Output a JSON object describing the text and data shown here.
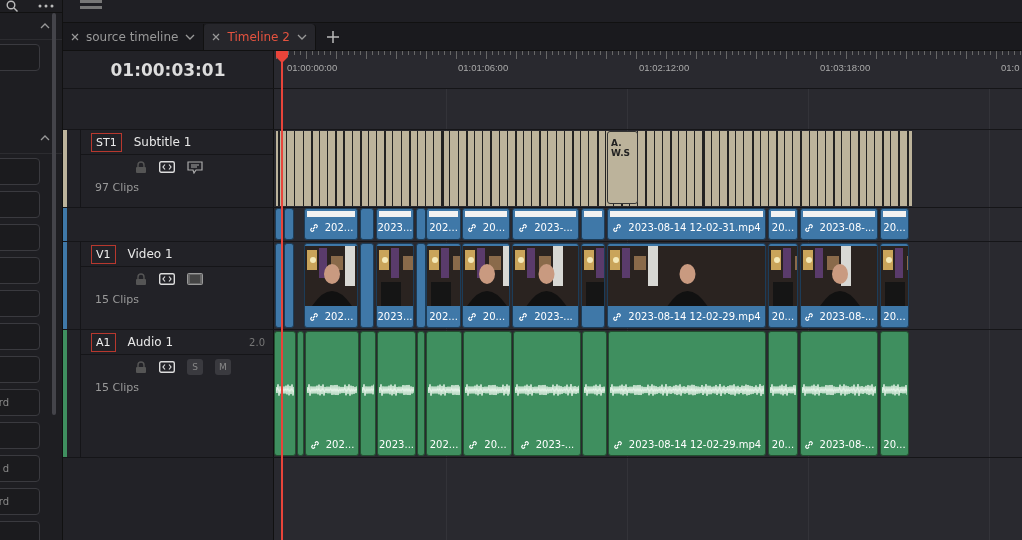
{
  "sidebar": {
    "panels": [
      {
        "expanded": true,
        "buttons": [
          {
            "kind": "blank"
          }
        ]
      },
      {
        "expanded": true,
        "buttons": [
          {
            "kind": "blank"
          },
          {
            "kind": "blank"
          },
          {
            "kind": "blank"
          },
          {
            "kind": "blank"
          },
          {
            "kind": "blank"
          },
          {
            "kind": "blank"
          },
          {
            "kind": "blank"
          },
          {
            "kind": "text",
            "label": "rd"
          },
          {
            "kind": "blank"
          },
          {
            "kind": "text",
            "label": "d"
          },
          {
            "kind": "text",
            "label": "rd"
          },
          {
            "kind": "blank"
          }
        ]
      }
    ]
  },
  "tabs": [
    {
      "label": "source timeline",
      "selected": false
    },
    {
      "label": "Timeline 2",
      "selected": true
    }
  ],
  "timecode": "01:00:03:01",
  "ruler": [
    "01:00:00:00",
    "01:01:06:00",
    "01:02:12:00",
    "01:03:18:00",
    "01:0"
  ],
  "tracks": [
    {
      "kind": "subtitle",
      "badge": "ST1",
      "name": "Subtitle 1",
      "clip_count": "97 Clips",
      "clips": [
        {
          "lines": [
            "A.",
            "W.S"
          ]
        }
      ]
    },
    {
      "kind": "video_strip",
      "clips": [
        {
          "linked": false
        },
        {
          "linked": false
        },
        {
          "label": "202...",
          "linked": true
        },
        {
          "linked": false
        },
        {
          "label": "2023...",
          "linked": false
        },
        {
          "linked": false
        },
        {
          "label": "202...",
          "linked": false
        },
        {
          "label": "20...",
          "linked": true
        },
        {
          "label": "2023-...",
          "linked": true
        },
        {
          "linked": false
        },
        {
          "label": "2023-08-14 12-02-31.mp4",
          "linked": true
        },
        {
          "label": "20...",
          "linked": false
        },
        {
          "label": "2023-08-...",
          "linked": true
        },
        {
          "label": "20...",
          "linked": false
        }
      ]
    },
    {
      "kind": "video",
      "badge": "V1",
      "name": "Video 1",
      "clip_count": "15 Clips",
      "clips": [
        {
          "linked": false
        },
        {
          "linked": false
        },
        {
          "label": "202...",
          "linked": true
        },
        {
          "linked": false
        },
        {
          "label": "2023...",
          "linked": false
        },
        {
          "linked": false
        },
        {
          "label": "202...",
          "linked": false
        },
        {
          "label": "20...",
          "linked": true
        },
        {
          "label": "2023-...",
          "linked": true
        },
        {
          "linked": false
        },
        {
          "label": "2023-08-14 12-02-29.mp4",
          "linked": true
        },
        {
          "label": "20...",
          "linked": false
        },
        {
          "label": "2023-08-...",
          "linked": true
        },
        {
          "label": "20...",
          "linked": false
        }
      ]
    },
    {
      "kind": "audio",
      "badge": "A1",
      "name": "Audio 1",
      "format": "2.0",
      "solo": "S",
      "mute": "M",
      "clip_count": "15 Clips",
      "clips": [
        {
          "linked": false
        },
        {
          "linked": false
        },
        {
          "label": "202...",
          "linked": true
        },
        {
          "linked": false
        },
        {
          "label": "2023...",
          "linked": false
        },
        {
          "linked": false
        },
        {
          "label": "202...",
          "linked": false
        },
        {
          "label": "20...",
          "linked": true
        },
        {
          "label": "2023-...",
          "linked": true
        },
        {
          "linked": false
        },
        {
          "label": "2023-08-14 12-02-29.mp4",
          "linked": true
        },
        {
          "label": "20...",
          "linked": false
        },
        {
          "label": "2023-08-...",
          "linked": true
        },
        {
          "label": "20...",
          "linked": false
        }
      ]
    }
  ]
}
